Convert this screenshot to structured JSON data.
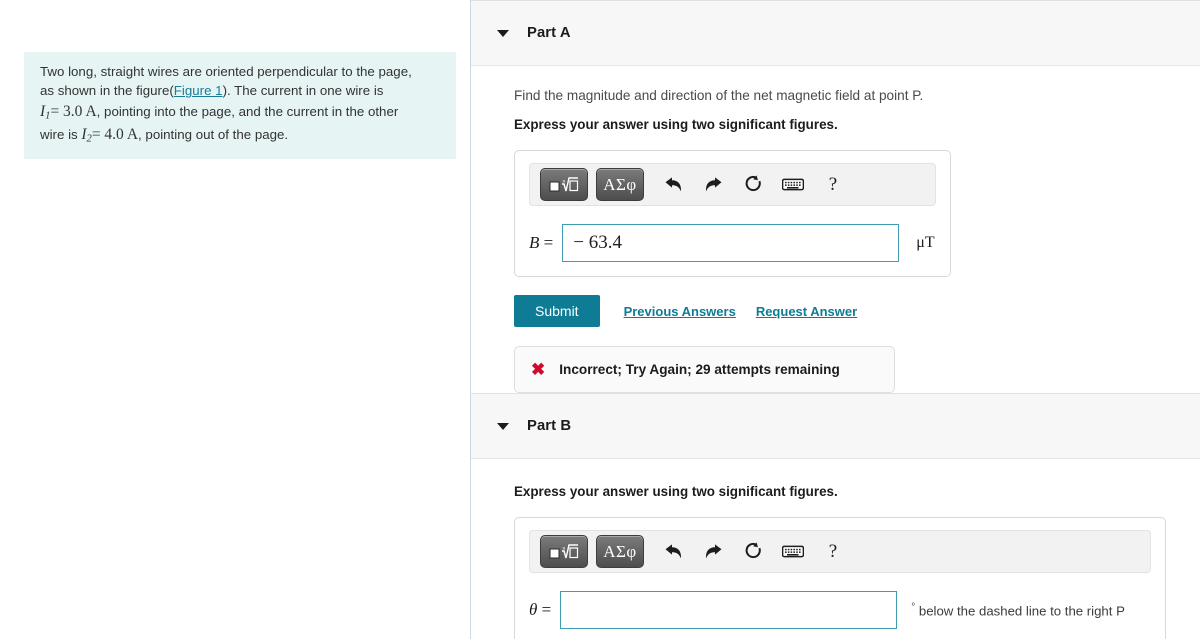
{
  "problem": {
    "line1": "Two long, straight wires are oriented perpendicular to the page,",
    "line2_pre": "as shown in the figure(",
    "figure_link": "Figure 1",
    "line2_post": "). The current in one wire is",
    "i1_symbol": "I",
    "i1_sub": "1",
    "i1_value": "= 3.0 A",
    "line3_post": ", pointing into the page, and the current in the other",
    "line4_pre": "wire is ",
    "i2_symbol": "I",
    "i2_sub": "2",
    "i2_value": "= 4.0 A",
    "line4_post": ", pointing out of the page."
  },
  "colors": {
    "accent_teal": "#0e7c95",
    "input_border": "#3f9cb5",
    "problem_bg": "#e6f4f4",
    "error_red": "#cf0a2c",
    "header_bg": "#f7f7f7"
  },
  "toolbar": {
    "template_button": "math-template",
    "greek_button": "ΑΣφ",
    "undo": "↰",
    "redo": "↱",
    "reset": "↻",
    "keyboard": "keyboard",
    "help": "?"
  },
  "part_a": {
    "title": "Part A",
    "question": "Find the magnitude and direction of the net magnetic field at point P.",
    "instruction": "Express your answer using two significant figures.",
    "variable": "B",
    "equals": "=",
    "value": "− 63.4",
    "placeholder": "",
    "unit": "μT",
    "submit_label": "Submit",
    "previous_answers_label": "Previous Answers",
    "request_answer_label": "Request Answer",
    "feedback_icon": "✖",
    "feedback_text": "Incorrect; Try Again; 29 attempts remaining"
  },
  "part_b": {
    "title": "Part B",
    "instruction": "Express your answer using two significant figures.",
    "variable": "θ",
    "equals": "=",
    "value": "",
    "placeholder": "",
    "unit_degree": "°",
    "unit_suffix": "below the dashed line to the right P"
  }
}
